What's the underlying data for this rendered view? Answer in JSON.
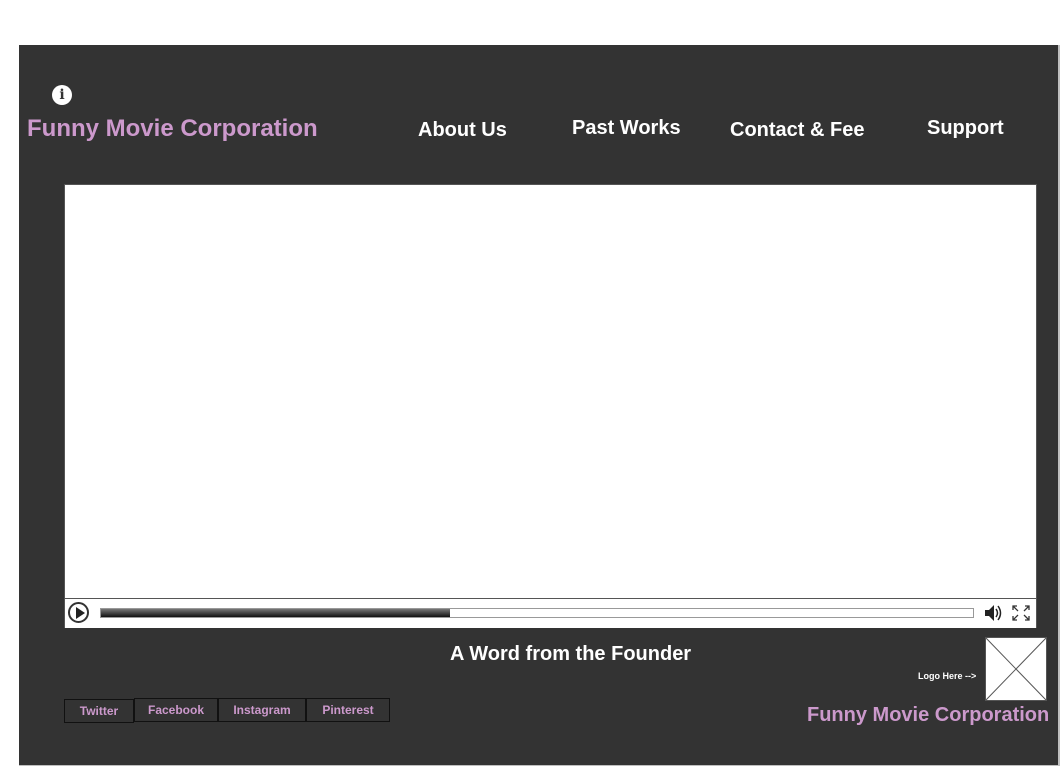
{
  "header": {
    "info_icon": "info-icon",
    "brand": "Funny Movie Corporation",
    "nav": [
      "About Us",
      "Past Works",
      "Contact & Fee",
      "Support"
    ]
  },
  "video_player": {
    "progress": 0.4,
    "icons": [
      "play-icon",
      "volume-icon",
      "fullscreen-icon"
    ]
  },
  "main": {
    "caption": "A Word from the Founder"
  },
  "social": [
    "Twitter",
    "Facebook",
    "Instagram",
    "Pinterest"
  ],
  "footer": {
    "logo_label": "Logo Here -->",
    "logo_icon": "logo-placeholder-icon",
    "brand": "Funny Movie Corporation"
  },
  "colors": {
    "background": "#333333",
    "accent": "#cc99cc",
    "text": "#ffffff"
  }
}
